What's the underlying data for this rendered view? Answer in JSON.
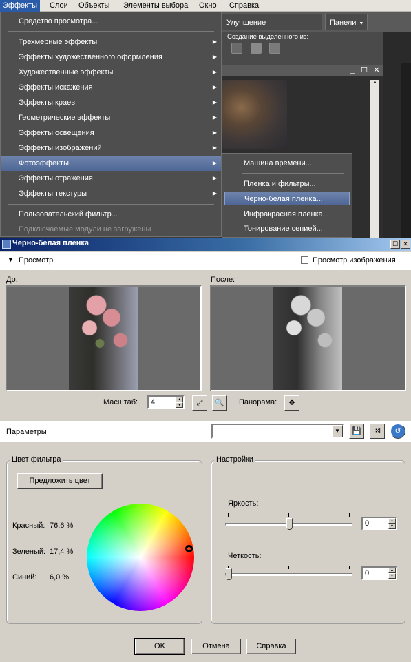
{
  "menubar": {
    "items": [
      "Эффекты",
      "Слои",
      "Объекты",
      "Элементы выбора",
      "Окно",
      "Справка"
    ],
    "active": "Эффекты"
  },
  "toolbar": {
    "photo_enhance": "Улучшение фотографии",
    "panels": "Панели",
    "selection_label": "Создание выделенного из:"
  },
  "effects_menu": {
    "items": [
      "Средство просмотра...",
      "Трехмерные эффекты",
      "Эффекты художественного оформления",
      "Художественные эффекты",
      "Эффекты искажения",
      "Эффекты краев",
      "Геометрические эффекты",
      "Эффекты освещения",
      "Эффекты изображений",
      "Фотоэффекты",
      "Эффекты отражения",
      "Эффекты текстуры",
      "Пользовательский фильтр...",
      "Подключаемые модули не загружены"
    ],
    "highlighted": "Фотоэффекты"
  },
  "photo_submenu": {
    "items": [
      "Машина времени...",
      "Пленка и фильтры...",
      "Черно-белая пленка...",
      "Инфракрасная пленка...",
      "Тонирование сепией..."
    ],
    "highlighted": "Черно-белая пленка..."
  },
  "dialog": {
    "title": "Черно-белая пленка",
    "preview_toggle": "Просмотр",
    "preview_images_checkbox": "Просмотр изображения",
    "before_label": "До:",
    "after_label": "После:",
    "zoom_label": "Масштаб:",
    "zoom_value": "4",
    "pan_label": "Панорама:",
    "params_label": "Параметры",
    "preset_value": "",
    "filter_color": {
      "title": "Цвет фильтра",
      "suggest_button": "Предложить цвет",
      "red_label": "Красный:",
      "red_value": "76,6 %",
      "green_label": "Зеленый:",
      "green_value": "17,4 %",
      "blue_label": "Синий:",
      "blue_value": "6,0 %"
    },
    "settings": {
      "title": "Настройки",
      "brightness_label": "Яркость:",
      "brightness_value": "0",
      "brightness_level": 0.5,
      "sharpness_label": "Четкость:",
      "sharpness_value": "0",
      "sharpness_level": 0.0
    },
    "buttons": {
      "ok": "OK",
      "cancel": "Отмена",
      "help": "Справка"
    }
  }
}
